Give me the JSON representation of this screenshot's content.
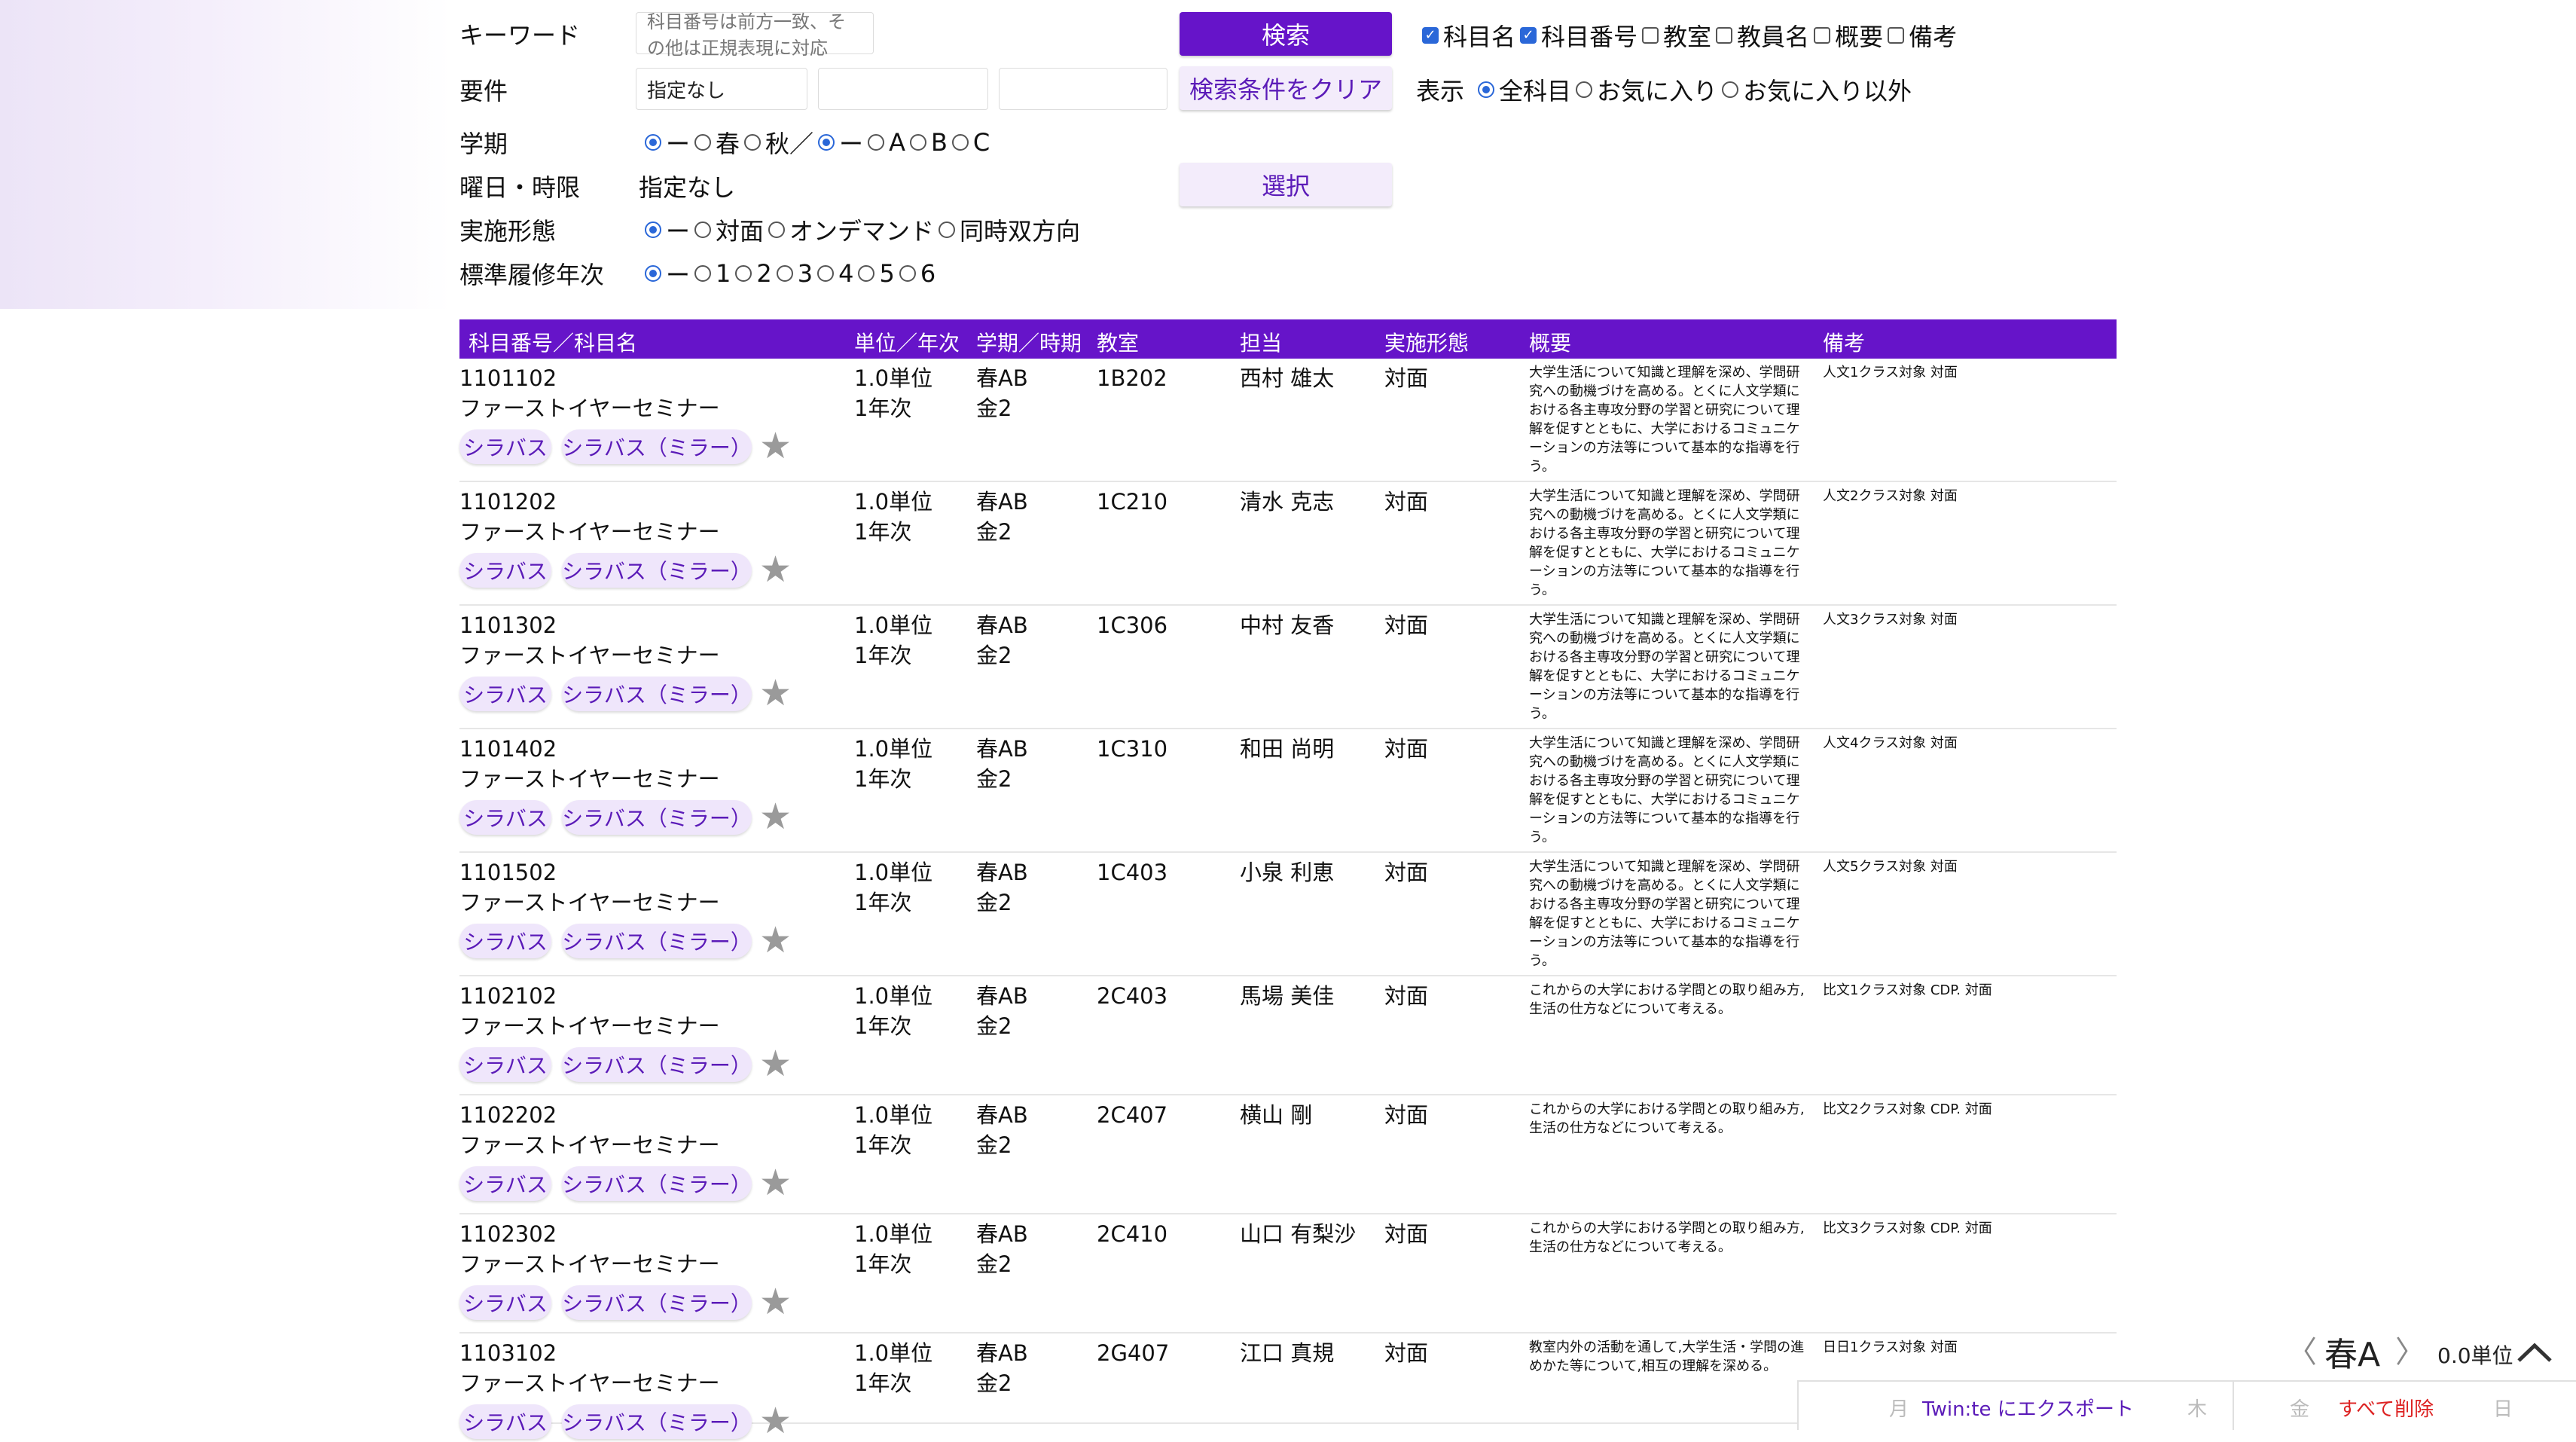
{
  "search": {
    "keyword_label": "キーワード",
    "keyword_placeholder": "科目番号は前方一致、その他は正規表現に対応",
    "search_button": "検索",
    "targets": [
      {
        "label": "科目名",
        "checked": true
      },
      {
        "label": "科目番号",
        "checked": true
      },
      {
        "label": "教室",
        "checked": false
      },
      {
        "label": "教員名",
        "checked": false
      },
      {
        "label": "概要",
        "checked": false
      },
      {
        "label": "備考",
        "checked": false
      }
    ],
    "requirement_label": "要件",
    "requirement_value": "指定なし",
    "clear_button": "検索条件をクリア",
    "display_label": "表示",
    "display_options": [
      {
        "label": "全科目",
        "selected": true
      },
      {
        "label": "お気に入り",
        "selected": false
      },
      {
        "label": "お気に入り以外",
        "selected": false
      }
    ],
    "term_label": "学期",
    "term_options_a": [
      {
        "label": "ー",
        "selected": true
      },
      {
        "label": "春",
        "selected": false
      },
      {
        "label": "秋／",
        "selected": false
      }
    ],
    "term_options_b": [
      {
        "label": "ー",
        "selected": true
      },
      {
        "label": "A",
        "selected": false
      },
      {
        "label": "B",
        "selected": false
      },
      {
        "label": "C",
        "selected": false
      }
    ],
    "day_period_label": "曜日・時限",
    "day_period_value": "指定なし",
    "select_button": "選択",
    "format_label": "実施形態",
    "format_options": [
      {
        "label": "ー",
        "selected": true
      },
      {
        "label": "対面",
        "selected": false
      },
      {
        "label": "オンデマンド",
        "selected": false
      },
      {
        "label": "同時双方向",
        "selected": false
      }
    ],
    "year_label": "標準履修年次",
    "year_options": [
      {
        "label": "ー",
        "selected": true
      },
      {
        "label": "1",
        "selected": false
      },
      {
        "label": "2",
        "selected": false
      },
      {
        "label": "3",
        "selected": false
      },
      {
        "label": "4",
        "selected": false
      },
      {
        "label": "5",
        "selected": false
      },
      {
        "label": "6",
        "selected": false
      }
    ]
  },
  "table": {
    "headers": {
      "code_name": "科目番号／科目名",
      "credit_year": "単位／年次",
      "term_time": "学期／時期",
      "room": "教室",
      "teacher": "担当",
      "format": "実施形態",
      "summary": "概要",
      "note": "備考"
    },
    "syllabus_label": "シラバス",
    "mirror_label": "シラバス（ミラー）",
    "rows": [
      {
        "code": "1101102",
        "name": "ファーストイヤーセミナー",
        "credit": "1.0単位",
        "year": "1年次",
        "term": "春AB",
        "time": "金2",
        "room": "1B202",
        "teacher": "西村 雄太",
        "format": "対面",
        "summary": "大学生活について知識と理解を深め、学問研究への動機づけを高める。とくに人文学類における各主専攻分野の学習と研究について理解を促すとともに、大学におけるコミュニケーションの方法等について基本的な指導を行う。",
        "note": "人文1クラス対象 対面"
      },
      {
        "code": "1101202",
        "name": "ファーストイヤーセミナー",
        "credit": "1.0単位",
        "year": "1年次",
        "term": "春AB",
        "time": "金2",
        "room": "1C210",
        "teacher": "清水 克志",
        "format": "対面",
        "summary": "大学生活について知識と理解を深め、学問研究への動機づけを高める。とくに人文学類における各主専攻分野の学習と研究について理解を促すとともに、大学におけるコミュニケーションの方法等について基本的な指導を行う。",
        "note": "人文2クラス対象 対面"
      },
      {
        "code": "1101302",
        "name": "ファーストイヤーセミナー",
        "credit": "1.0単位",
        "year": "1年次",
        "term": "春AB",
        "time": "金2",
        "room": "1C306",
        "teacher": "中村 友香",
        "format": "対面",
        "summary": "大学生活について知識と理解を深め、学問研究への動機づけを高める。とくに人文学類における各主専攻分野の学習と研究について理解を促すとともに、大学におけるコミュニケーションの方法等について基本的な指導を行う。",
        "note": "人文3クラス対象 対面"
      },
      {
        "code": "1101402",
        "name": "ファーストイヤーセミナー",
        "credit": "1.0単位",
        "year": "1年次",
        "term": "春AB",
        "time": "金2",
        "room": "1C310",
        "teacher": "和田 尚明",
        "format": "対面",
        "summary": "大学生活について知識と理解を深め、学問研究への動機づけを高める。とくに人文学類における各主専攻分野の学習と研究について理解を促すとともに、大学におけるコミュニケーションの方法等について基本的な指導を行う。",
        "note": "人文4クラス対象 対面"
      },
      {
        "code": "1101502",
        "name": "ファーストイヤーセミナー",
        "credit": "1.0単位",
        "year": "1年次",
        "term": "春AB",
        "time": "金2",
        "room": "1C403",
        "teacher": "小泉 利恵",
        "format": "対面",
        "summary": "大学生活について知識と理解を深め、学問研究への動機づけを高める。とくに人文学類における各主専攻分野の学習と研究について理解を促すとともに、大学におけるコミュニケーションの方法等について基本的な指導を行う。",
        "note": "人文5クラス対象 対面"
      },
      {
        "code": "1102102",
        "name": "ファーストイヤーセミナー",
        "credit": "1.0単位",
        "year": "1年次",
        "term": "春AB",
        "time": "金2",
        "room": "2C403",
        "teacher": "馬場 美佳",
        "format": "対面",
        "summary": "これからの大学における学問との取り組み方,生活の仕方などについて考える。",
        "note": "比文1クラス対象 CDP. 対面"
      },
      {
        "code": "1102202",
        "name": "ファーストイヤーセミナー",
        "credit": "1.0単位",
        "year": "1年次",
        "term": "春AB",
        "time": "金2",
        "room": "2C407",
        "teacher": "横山 剛",
        "format": "対面",
        "summary": "これからの大学における学問との取り組み方,生活の仕方などについて考える。",
        "note": "比文2クラス対象 CDP. 対面"
      },
      {
        "code": "1102302",
        "name": "ファーストイヤーセミナー",
        "credit": "1.0単位",
        "year": "1年次",
        "term": "春AB",
        "time": "金2",
        "room": "2C410",
        "teacher": "山口 有梨沙",
        "format": "対面",
        "summary": "これからの大学における学問との取り組み方,生活の仕方などについて考える。",
        "note": "比文3クラス対象 CDP. 対面"
      },
      {
        "code": "1103102",
        "name": "ファーストイヤーセミナー",
        "credit": "1.0単位",
        "year": "1年次",
        "term": "春AB",
        "time": "金2",
        "room": "2G407",
        "teacher": "江口 真規",
        "format": "対面",
        "summary": "教室内外の活動を通して,大学生活・学問の進めかた等について,相互の理解を深める。",
        "note": "日日1クラス対象 対面"
      }
    ]
  },
  "timetable": {
    "prev_icon": "〈",
    "term": "春A",
    "next_icon": "〉",
    "credits": "0.0単位",
    "expand_icon": "chevron-up",
    "day_mon": "月",
    "export_label": "Twin:te にエクスポート",
    "day_thu": "木",
    "day_fri": "金",
    "delete_all": "すべて削除",
    "day_sun": "日"
  }
}
